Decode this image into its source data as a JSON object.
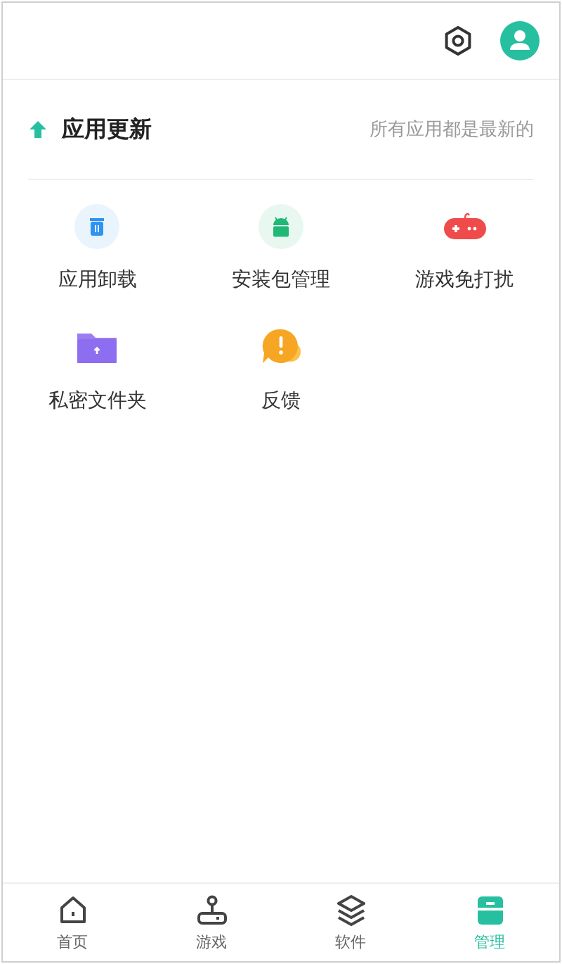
{
  "header": {
    "actions": [
      {
        "kind": "settings"
      },
      {
        "kind": "avatar"
      }
    ]
  },
  "update": {
    "title": "应用更新",
    "status": "所有应用都是最新的"
  },
  "tools": [
    {
      "kind": "trash",
      "label": "应用卸载"
    },
    {
      "kind": "android",
      "label": "安装包管理"
    },
    {
      "kind": "gamepad",
      "label": "游戏免打扰"
    },
    {
      "kind": "folder",
      "label": "私密文件夹"
    },
    {
      "kind": "feedback",
      "label": "反馈"
    }
  ],
  "bottom_nav": [
    {
      "kind": "home",
      "label": "首页",
      "selected": false
    },
    {
      "kind": "game",
      "label": "游戏",
      "selected": false
    },
    {
      "kind": "layers",
      "label": "软件",
      "selected": false
    },
    {
      "kind": "manage",
      "label": "管理",
      "selected": true
    }
  ]
}
